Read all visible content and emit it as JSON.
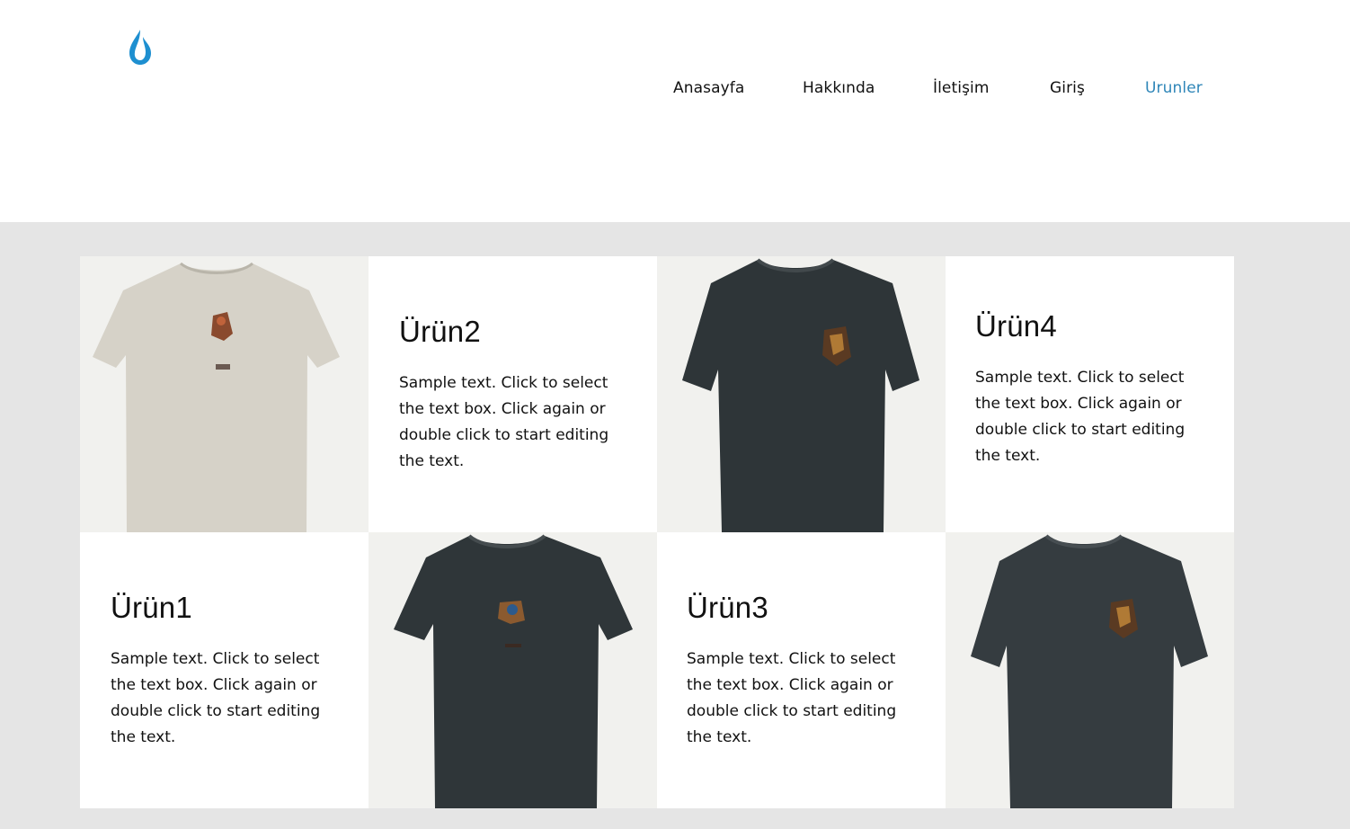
{
  "header": {
    "logo_icon": "water-drop-icon",
    "logo_color": "#1e8fd0"
  },
  "nav": {
    "items": [
      {
        "label": "Anasayfa",
        "active": false
      },
      {
        "label": "Hakkında",
        "active": false
      },
      {
        "label": "İletişim",
        "active": false
      },
      {
        "label": "Giriş",
        "active": false
      },
      {
        "label": "Urunler",
        "active": true
      }
    ],
    "active_color": "#2f86b8"
  },
  "products": [
    {
      "title": "Ürün2",
      "text": "Sample text. Click to select the text box. Click again or double click to start editing the text."
    },
    {
      "title": "Ürün4",
      "text": "Sample text. Click to select the text box. Click again or double click to start editing the text."
    },
    {
      "title": "Ürün1",
      "text": "Sample text. Click to select the text box. Click again or double click to start editing the text."
    },
    {
      "title": "Ürün3",
      "text": "Sample text. Click to select the text box. Click again or double click to start editing the text."
    }
  ],
  "product_images": [
    {
      "icon": "beige-tshirt-image",
      "color": "#d6d2c8"
    },
    {
      "icon": "dark-tshirt-image",
      "color": "#2e3538"
    },
    {
      "icon": "dark-tshirt-image",
      "color": "#2f3639"
    },
    {
      "icon": "dark-tshirt-image",
      "color": "#353c40"
    }
  ],
  "colors": {
    "section_background": "#e5e5e5",
    "image_background": "#f1f1ee"
  }
}
